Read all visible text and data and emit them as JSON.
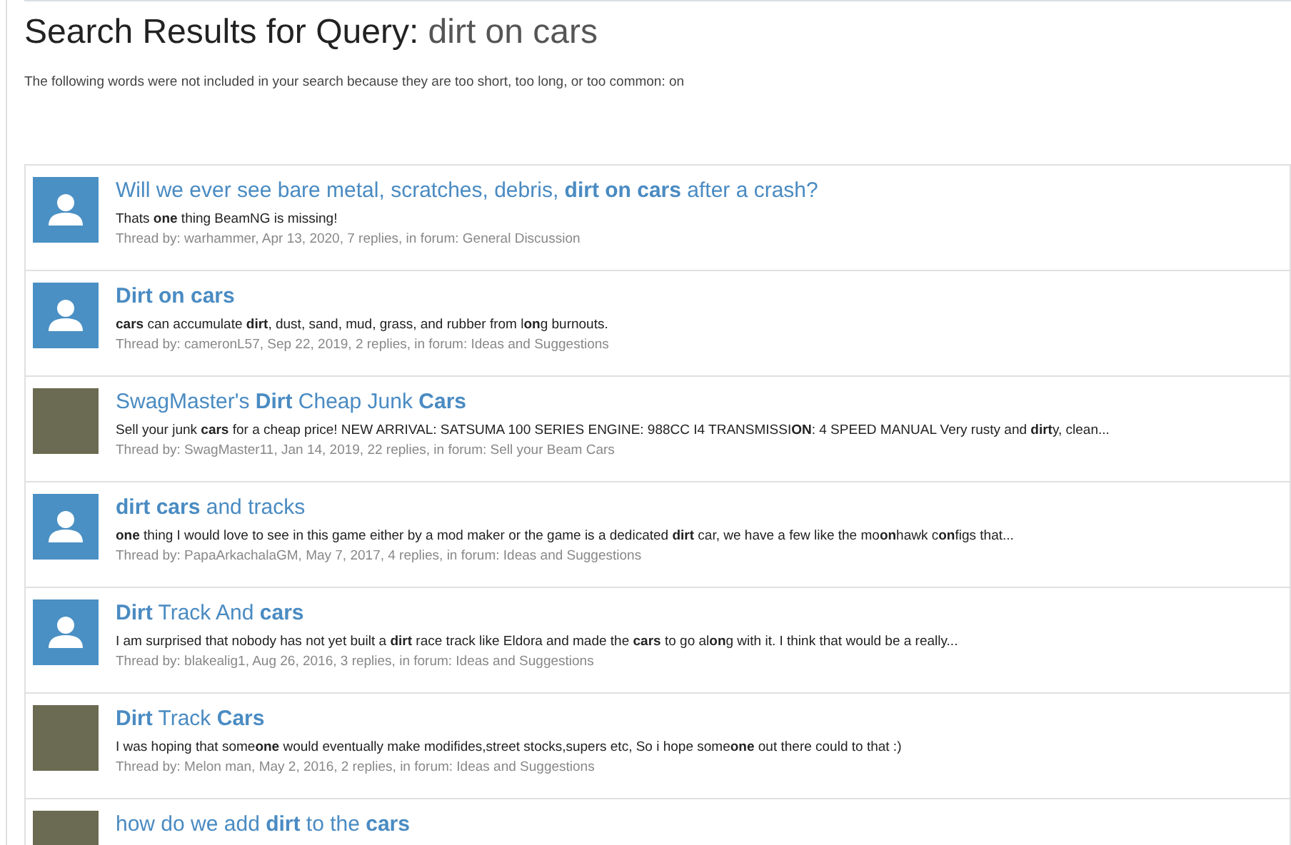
{
  "heading": {
    "label": "Search Results for Query:",
    "query": "dirt on cars"
  },
  "notice": "The following words were not included in your search because they are too short, too long, or too common: on",
  "results": [
    {
      "kind": "default",
      "title": "Will we ever see bare metal, scratches, debris, **dirt on cars** after a crash?",
      "snippet": "Thats **one** thing BeamNG is missing!",
      "meta": "Thread by: warhammer, Apr 13, 2020, 7 replies, in forum: General Discussion"
    },
    {
      "kind": "default",
      "title": "**Dirt on cars**",
      "snippet": "**cars** can accumulate **dirt**, dust, sand, mud, grass, and rubber from l**on**g burnouts.",
      "meta": "Thread by: cameronL57, Sep 22, 2019, 2 replies, in forum: Ideas and Suggestions"
    },
    {
      "kind": "photo",
      "title": "SwagMaster's **Dirt** Cheap Junk **Cars**",
      "snippet": "Sell your junk **cars** for a cheap price! NEW ARRIVAL: SATSUMA 100 SERIES ENGINE: 988CC I4 TRANSMISSI**ON**: 4 SPEED MANUAL Very rusty and **dirt**y, clean...",
      "meta": "Thread by: SwagMaster11, Jan 14, 2019, 22 replies, in forum: Sell your Beam Cars"
    },
    {
      "kind": "default",
      "title": "**dirt cars** and tracks",
      "snippet": "**one** thing I would love to see in this game either by a mod maker or the game is a dedicated **dirt** car, we have a few like the mo**on**hawk c**on**figs that...",
      "meta": "Thread by: PapaArkachalaGM, May 7, 2017, 4 replies, in forum: Ideas and Suggestions"
    },
    {
      "kind": "default",
      "title": "**Dirt** Track And **cars**",
      "snippet": "I am surprised that nobody has not yet built a **dirt** race track like Eldora and made the **cars** to go al**on**g with it. I think that would be a really...",
      "meta": "Thread by: blakealig1, Aug 26, 2016, 3 replies, in forum: Ideas and Suggestions"
    },
    {
      "kind": "photo",
      "title": "**Dirt** Track **Cars**",
      "snippet": "I was hoping that some**one** would eventually make modifides,street stocks,supers etc, So i hope some**one** out there could to that :)",
      "meta": "Thread by: Melon man, May 2, 2016, 2 replies, in forum: Ideas and Suggestions"
    },
    {
      "kind": "photo",
      "title": "how do we add **dirt** to the **cars**"
    }
  ]
}
